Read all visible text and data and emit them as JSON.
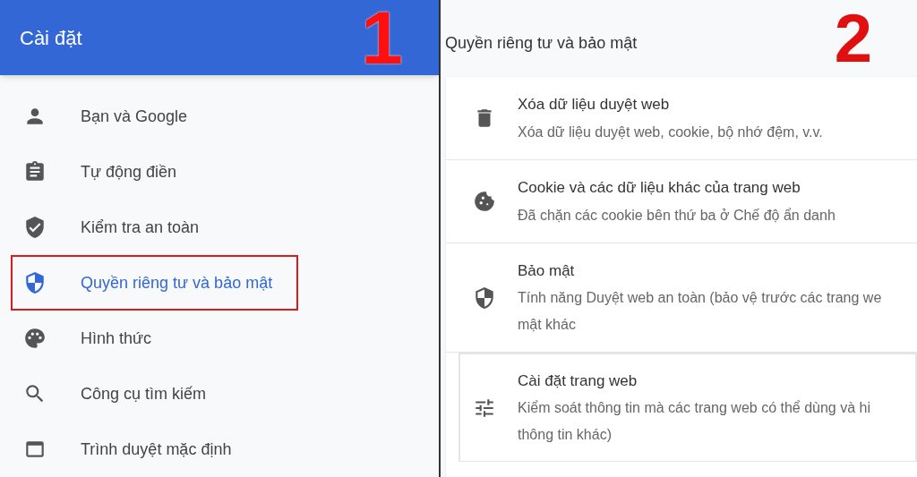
{
  "left_panel": {
    "title": "Cài đặt",
    "step": "1",
    "items": [
      {
        "label": "Bạn và Google",
        "selected": false,
        "highlighted": false
      },
      {
        "label": "Tự động điền",
        "selected": false,
        "highlighted": false
      },
      {
        "label": "Kiểm tra an toàn",
        "selected": false,
        "highlighted": false
      },
      {
        "label": "Quyền riêng tư và bảo mật",
        "selected": true,
        "highlighted": true
      },
      {
        "label": "Hình thức",
        "selected": false,
        "highlighted": false
      },
      {
        "label": "Công cụ tìm kiếm",
        "selected": false,
        "highlighted": false
      },
      {
        "label": "Trình duyệt mặc định",
        "selected": false,
        "highlighted": false
      }
    ]
  },
  "right_panel": {
    "title": "Quyền riêng tư và bảo mật",
    "step": "2",
    "rows": [
      {
        "title": "Xóa dữ liệu duyệt web",
        "description": [
          "Xóa dữ liệu duyệt web, cookie, bộ nhớ đệm, v.v."
        ],
        "highlighted": false
      },
      {
        "title": "Cookie và các dữ liệu khác của trang web",
        "description": [
          "Đã chặn các cookie bên thứ ba ở Chế độ ẩn danh"
        ],
        "highlighted": false
      },
      {
        "title": "Bảo mật",
        "description": [
          "Tính năng Duyệt web an toàn (bảo vệ trước các trang we",
          "mật khác"
        ],
        "highlighted": false
      },
      {
        "title": "Cài đặt trang web",
        "description": [
          "Kiểm soát thông tin mà các trang web có thể dùng và hi",
          "thông tin khác)"
        ],
        "highlighted": true
      }
    ]
  }
}
